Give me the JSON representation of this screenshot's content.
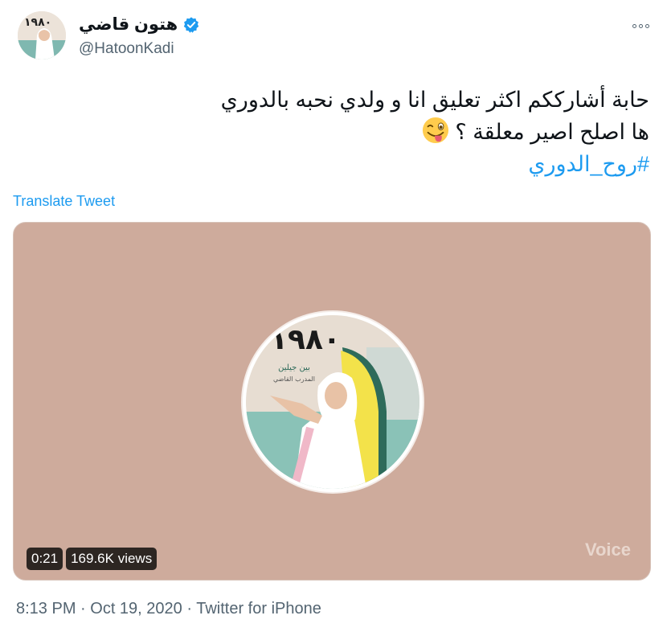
{
  "author": {
    "display_name": "هتون قاضي",
    "handle": "@HatoonKadi",
    "avatar_text": "١٩٨٠"
  },
  "tweet": {
    "lines": [
      "حابة أشارككم اكثر تعليق انا و ولدي نحبه بالدوري",
      "ها اصلح اصير معلقة ؟"
    ],
    "hashtag": "#روح_الدوري"
  },
  "translate_label": "Translate Tweet",
  "media": {
    "cover_title": "١٩٨٠",
    "cover_sub1": "بين جيلين",
    "cover_sub2": "المدرب القاضي",
    "voice_label": "Voice",
    "duration": "0:21",
    "views": "169.6K views"
  },
  "meta": {
    "time": "8:13 PM",
    "sep": " · ",
    "date": "Oct 19, 2020",
    "source": "Twitter for iPhone"
  },
  "colors": {
    "accent": "#1d9bf0",
    "media_bg": "#ceab9c",
    "text": "#0f1419",
    "muted": "#536471"
  },
  "icons": [
    "verified-badge-icon",
    "more-icon",
    "wink-tongue-emoji-icon"
  ]
}
